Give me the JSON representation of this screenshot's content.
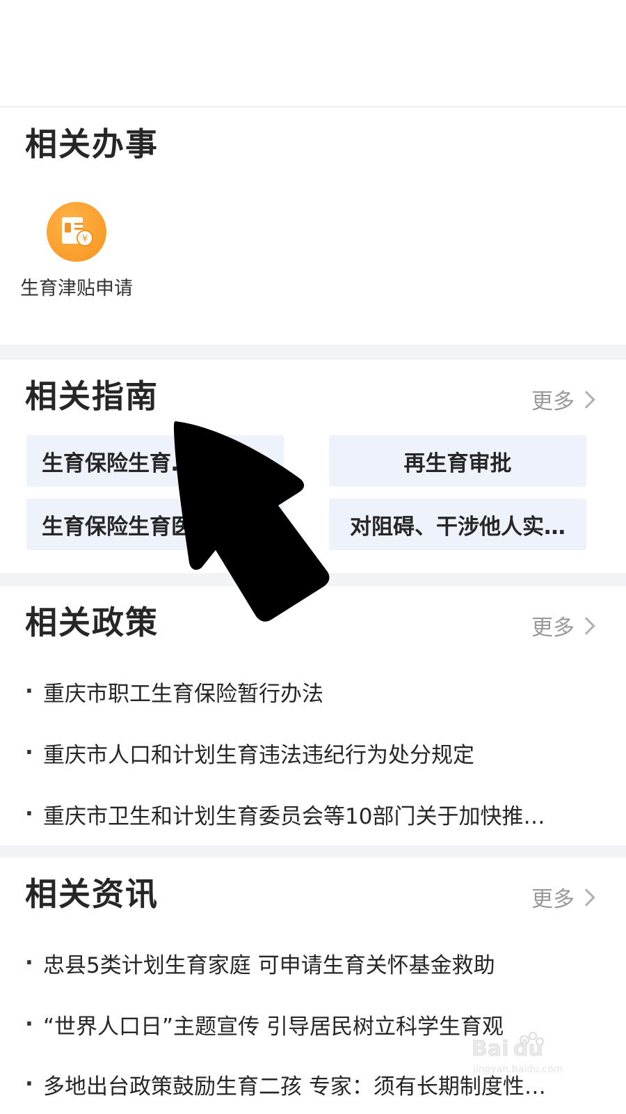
{
  "services": {
    "title": "相关办事",
    "items": [
      {
        "label": "生育津贴申请",
        "icon": "subsidy-card-icon",
        "icon_color": "#f7931e"
      }
    ]
  },
  "guides": {
    "title": "相关指南",
    "more_label": "更多",
    "items": [
      {
        "label": "生育保险生育…"
      },
      {
        "label": "再生育审批"
      },
      {
        "label": "生育保险生育医…"
      },
      {
        "label": "对阻碍、干涉他人实…"
      }
    ]
  },
  "policies": {
    "title": "相关政策",
    "more_label": "更多",
    "items": [
      {
        "label": "重庆市职工生育保险暂行办法"
      },
      {
        "label": "重庆市人口和计划生育违法违纪行为处分规定"
      },
      {
        "label": "重庆市卫生和计划生育委员会等10部门关于加快推…"
      }
    ]
  },
  "news": {
    "title": "相关资讯",
    "more_label": "更多",
    "items": [
      {
        "label": "忠县5类计划生育家庭 可申请生育关怀基金救助"
      },
      {
        "label": "“世界人口日”主题宣传 引导居民树立科学生育观"
      },
      {
        "label": "多地出台政策鼓励生育二孩 专家：须有长期制度性…"
      }
    ]
  },
  "bullet": "·",
  "watermark": {
    "brand": "Baidu经验",
    "url": "jingyan.baidu.com"
  },
  "colors": {
    "accent_orange": "#f7931e",
    "guide_bg": "#eef2fb",
    "muted": "#9a9a9a"
  }
}
